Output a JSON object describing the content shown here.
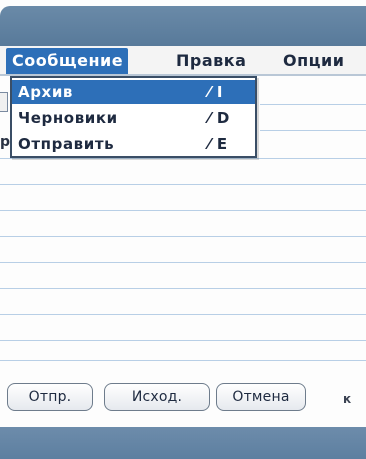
{
  "menu": {
    "message": "Сообщение",
    "edit": "Правка",
    "options": "Опции"
  },
  "dropdown": {
    "items": [
      {
        "label": "Архив",
        "shortcut": "⁄ I"
      },
      {
        "label": "Черновики",
        "shortcut": "⁄ D"
      },
      {
        "label": "Отправить",
        "shortcut": "⁄ E"
      }
    ],
    "selected_index": 0
  },
  "buttons": {
    "send": "Отпр.",
    "outbox": "Исход.",
    "cancel": "Отмена"
  },
  "left_mark": "р",
  "right_glyph": "к",
  "colors": {
    "accent": "#2d6fb8",
    "bar": "#5d7fa0",
    "line": "#b8cfe6"
  }
}
